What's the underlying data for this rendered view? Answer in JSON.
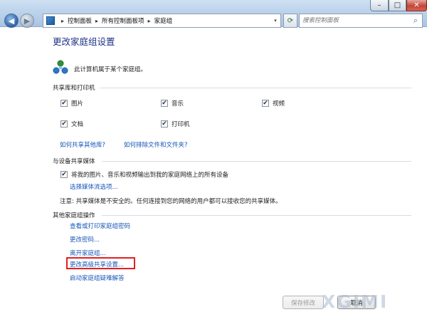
{
  "window": {
    "minimize_glyph": "–",
    "maximize_glyph": "□",
    "close_glyph": "✕"
  },
  "nav": {
    "back_glyph": "◀",
    "forward_glyph": "▶",
    "dropdown_glyph": "▾"
  },
  "breadcrumb": {
    "items": [
      "控制面板",
      "所有控制面板项",
      "家庭组"
    ],
    "separator": "▸",
    "dropdown_glyph": "▾"
  },
  "refresh_glyph": "⟳",
  "search": {
    "placeholder": "搜索控制面板",
    "icon_glyph": "⌕"
  },
  "page": {
    "title": "更改家庭组设置",
    "membership_text": "此计算机属于某个家庭组。"
  },
  "libraries": {
    "heading": "共享库和打印机",
    "items": [
      {
        "label": "图片",
        "checked": true
      },
      {
        "label": "音乐",
        "checked": true
      },
      {
        "label": "视频",
        "checked": true
      },
      {
        "label": "文档",
        "checked": true
      },
      {
        "label": "打印机",
        "checked": true
      }
    ],
    "links": [
      "如何共享其他库?",
      "如何排除文件和文件夹?"
    ]
  },
  "media": {
    "heading": "与设备共享媒体",
    "stream_label": "将我的图片、音乐和视频输出到我的家庭网络上的所有设备",
    "stream_checked": true,
    "options_link": "选择媒体流选项...",
    "note": "注意: 共享媒体是不安全的。任何连接到您的网络的用户都可以接收您的共享媒体。"
  },
  "other_actions": {
    "heading": "其他家庭组操作",
    "links": [
      "查看或打印家庭组密码",
      "更改密码...",
      "离开家庭组...",
      "更改高级共享设置...",
      "启动家庭组疑难解答"
    ]
  },
  "buttons": {
    "save": "保存修改",
    "cancel": "取消"
  },
  "watermark": "XGIMI",
  "colors": {
    "link": "#1657b8",
    "title": "#1e3287",
    "highlight_border": "#e32020"
  },
  "check_glyph": "✔"
}
